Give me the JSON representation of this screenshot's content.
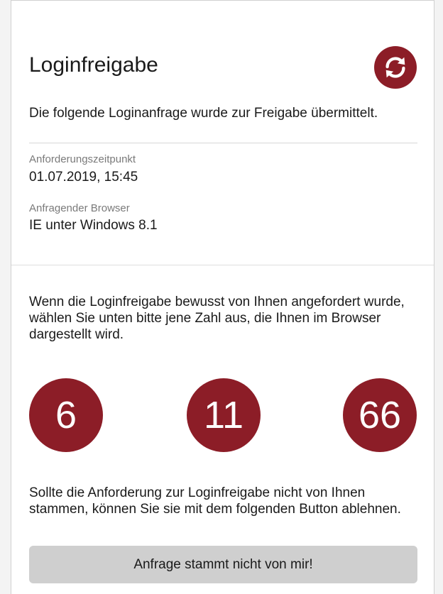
{
  "header": {
    "title": "Loginfreigabe",
    "refresh_icon": "refresh-icon"
  },
  "request": {
    "intro": "Die folgende Loginanfrage wurde zur Freigabe übermittelt.",
    "time_label": "Anforderungszeitpunkt",
    "time_value": "01.07.2019, 15:45",
    "browser_label": "Anfragender Browser",
    "browser_value": "IE unter Windows 8.1"
  },
  "selection": {
    "instruction": "Wenn die Loginfreigabe bewusst von Ihnen angefordert wurde, wählen Sie unten bitte jene Zahl aus, die Ihnen im Browser dargestellt wird.",
    "numbers": [
      "6",
      "11",
      "66"
    ]
  },
  "reject": {
    "text": "Sollte die Anforderung zur Loginfreigabe nicht von Ihnen stammen, können Sie sie mit dem folgenden Button ablehnen.",
    "button_label": "Anfrage stammt nicht von mir!"
  },
  "colors": {
    "accent": "#8c1d27",
    "button_bg": "#cfcfcf",
    "background": "#f3f3f3",
    "card": "#ffffff"
  }
}
